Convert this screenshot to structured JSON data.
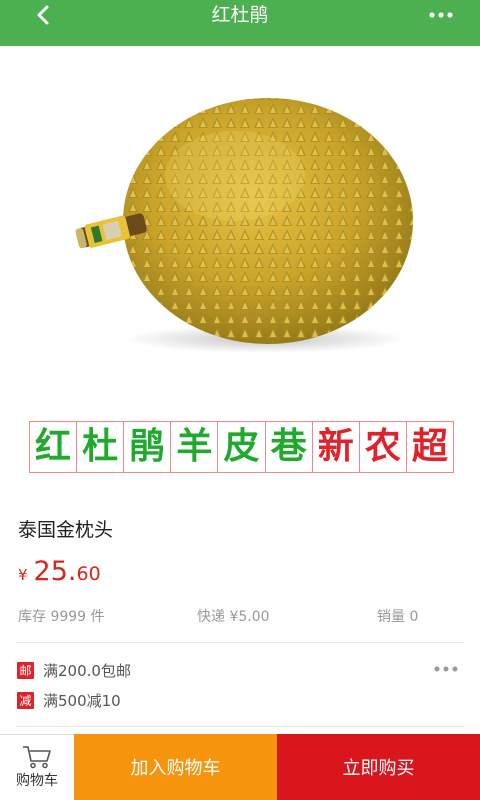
{
  "header": {
    "title": "红杜鹃",
    "back_icon": "chevron-left-icon",
    "more_icon": "more-horizontal-icon"
  },
  "banner": {
    "chars": [
      {
        "text": "红",
        "color": "#1faa2d"
      },
      {
        "text": "杜",
        "color": "#1faa2d"
      },
      {
        "text": "鹃",
        "color": "#1faa2d"
      },
      {
        "text": "羊",
        "color": "#1faa2d"
      },
      {
        "text": "皮",
        "color": "#1faa2d"
      },
      {
        "text": "巷",
        "color": "#1faa2d"
      },
      {
        "text": "新",
        "color": "#e0232b"
      },
      {
        "text": "农",
        "color": "#e0232b"
      },
      {
        "text": "超",
        "color": "#e0232b"
      }
    ]
  },
  "product": {
    "name": "泰国金枕头",
    "price_currency": "¥",
    "price_integer": "25.",
    "price_decimal": "60",
    "stock": "库存 9999 件",
    "shipping": "快递 ¥5.00",
    "sales": "销量 0"
  },
  "promotions": [
    {
      "tag": "邮",
      "text": "满200.0包邮"
    },
    {
      "tag": "减",
      "text": "满500减10"
    }
  ],
  "bottom_bar": {
    "cart_label": "购物车",
    "add_to_cart": "加入购物车",
    "buy_now": "立即购买"
  },
  "colors": {
    "header": "#4caf50",
    "price": "#d9251d",
    "add_to_cart": "#f7940e",
    "buy_now": "#d9161c"
  }
}
